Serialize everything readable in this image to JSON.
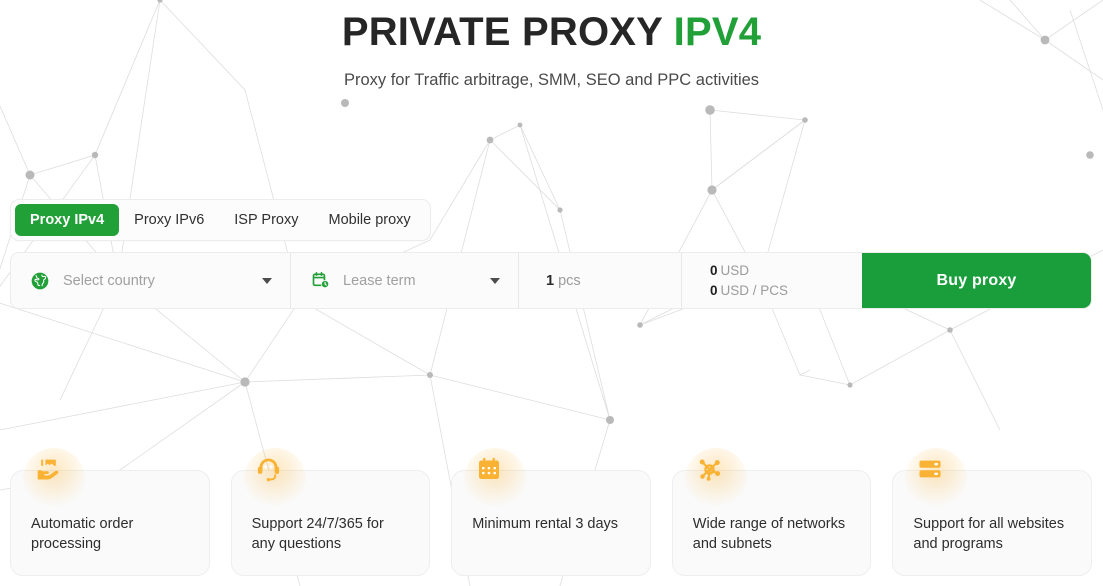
{
  "hero": {
    "title_main": "PRIVATE PROXY",
    "title_accent": "IPV4",
    "subtitle": "Proxy for Traffic arbitrage, SMM, SEO and PPC activities"
  },
  "tabs": [
    {
      "label": "Proxy IPv4",
      "active": true
    },
    {
      "label": "Proxy IPv6",
      "active": false
    },
    {
      "label": "ISP Proxy",
      "active": false
    },
    {
      "label": "Mobile proxy",
      "active": false
    }
  ],
  "order_bar": {
    "country": {
      "icon": "globe-icon",
      "placeholder": "Select country"
    },
    "lease": {
      "icon": "calendar-clock-icon",
      "placeholder": "Lease term"
    },
    "quantity": {
      "value": "1",
      "unit": "pcs"
    },
    "price": {
      "total_amount": "0",
      "total_currency": "USD",
      "unit_amount": "0",
      "unit_currency": "USD / PCS"
    },
    "buy_label": "Buy proxy"
  },
  "features": [
    {
      "icon": "hand-package-icon",
      "text": "Automatic order processing"
    },
    {
      "icon": "headset-icon",
      "text": "Support 24/7/365 for any questions"
    },
    {
      "icon": "calendar-icon",
      "text": "Minimum rental 3 days"
    },
    {
      "icon": "network-nodes-icon",
      "text": "Wide range of networks and subnets"
    },
    {
      "icon": "server-stack-icon",
      "text": "Support for all websites and programs"
    }
  ],
  "colors": {
    "brand_green": "#21a038",
    "buy_green": "#1a9e3c",
    "accent_amber": "#f9b233",
    "text_dark": "#262626",
    "text_muted": "#9b9b9b"
  }
}
